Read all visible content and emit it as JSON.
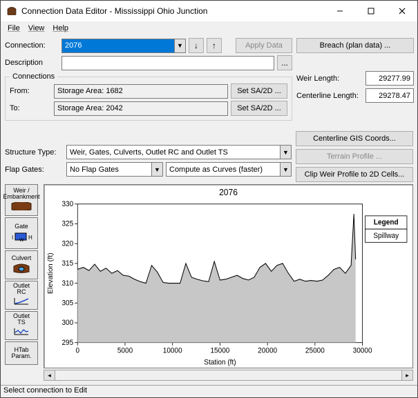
{
  "title": "Connection Data Editor - Mississippi Ohio Junction",
  "menus": [
    "File",
    "View",
    "Help"
  ],
  "rows": {
    "connection_label": "Connection:",
    "connection_value": "2076",
    "apply_data": "Apply Data",
    "breach": "Breach (plan data) ...",
    "description_label": "Description",
    "ellipsis": "...",
    "group_label": "Connections",
    "from_label": "From:",
    "from_value": "Storage Area: 1682",
    "to_label": "To:",
    "to_value": "Storage Area: 2042",
    "set_sa2d": "Set SA/2D ...",
    "weir_length_label": "Weir Length:",
    "weir_length_value": "29277.99",
    "centerline_length_label": "Centerline Length:",
    "centerline_length_value": "29278.47",
    "centerline_gis": "Centerline GIS Coords...",
    "terrain_profile": "Terrain Profile ...",
    "clip_weir": "Clip Weir Profile to 2D Cells...",
    "structure_type_label": "Structure Type:",
    "structure_type_value": "Weir, Gates, Culverts, Outlet RC and Outlet TS",
    "flap_gates_label": "Flap Gates:",
    "flap_gates_value": "No Flap Gates",
    "compute_mode": "Compute as Curves (faster)"
  },
  "tools": {
    "weir": "Weir /\nEmbankment",
    "gate": "Gate",
    "culvert": "Culvert",
    "outlet_rc": "Outlet\nRC",
    "outlet_ts": "Outlet\nTS",
    "htab": "HTab\nParam."
  },
  "chart_data": {
    "type": "area",
    "title": "2076",
    "xlabel": "Station (ft)",
    "ylabel": "Elevation (ft)",
    "xlim": [
      0,
      30000
    ],
    "ylim": [
      295,
      330
    ],
    "legend": {
      "title": "Legend",
      "series": [
        "Spillway"
      ]
    },
    "x_ticks": [
      0,
      5000,
      10000,
      15000,
      20000,
      25000,
      30000
    ],
    "y_ticks": [
      295,
      300,
      305,
      310,
      315,
      320,
      325,
      330
    ],
    "series": [
      {
        "name": "Spillway",
        "x": [
          0,
          600,
          1200,
          1800,
          2400,
          3000,
          3600,
          4200,
          4800,
          5400,
          6000,
          6600,
          7200,
          7800,
          8400,
          9000,
          9600,
          10200,
          10800,
          11400,
          12000,
          12600,
          13200,
          13800,
          14400,
          15000,
          15600,
          16200,
          16800,
          17400,
          18000,
          18600,
          19200,
          19800,
          20400,
          21000,
          21600,
          22200,
          22800,
          23400,
          24000,
          24600,
          25200,
          25800,
          26400,
          27000,
          27600,
          28200,
          28800,
          29100,
          29278
        ],
        "y": [
          313.5,
          314.0,
          313.2,
          314.8,
          313.0,
          313.8,
          312.5,
          313.2,
          312.0,
          311.8,
          311.0,
          310.4,
          310.0,
          314.5,
          312.8,
          310.2,
          310.0,
          310.0,
          310.0,
          315.0,
          311.5,
          311.0,
          310.6,
          310.4,
          315.5,
          310.8,
          311.0,
          311.5,
          312.0,
          311.2,
          310.8,
          311.5,
          314.0,
          315.0,
          313.0,
          314.5,
          315.0,
          312.5,
          310.5,
          311.0,
          310.5,
          310.7,
          310.5,
          310.8,
          312.0,
          313.5,
          314.0,
          312.5,
          314.5,
          327.5,
          316.0
        ]
      }
    ]
  },
  "status": "Select connection to Edit"
}
